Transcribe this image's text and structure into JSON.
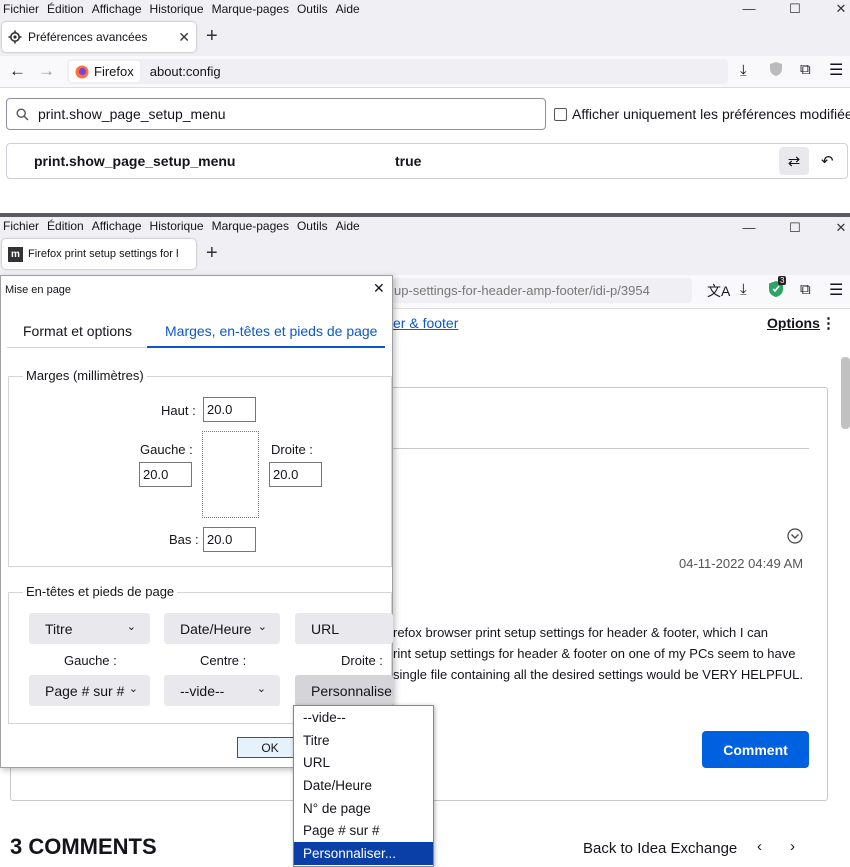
{
  "top_window": {
    "menu": [
      "Fichier",
      "Édition",
      "Affichage",
      "Historique",
      "Marque-pages",
      "Outils",
      "Aide"
    ],
    "tab_title": "Préférences avancées",
    "url_identity": "Firefox",
    "url": "about:config",
    "search_value": "print.show_page_setup_menu",
    "modified_only_label": "Afficher uniquement les préférences modifiées",
    "pref_name": "print.show_page_setup_menu",
    "pref_value": "true"
  },
  "bottom_window": {
    "menu": [
      "Fichier",
      "Édition",
      "Affichage",
      "Historique",
      "Marque-pages",
      "Outils",
      "Aide"
    ],
    "tab_title": "Firefox print setup settings for h",
    "url_partial": "up-settings-for-header-amp-footer/idi-p/3954",
    "extension_badge": "3"
  },
  "page": {
    "breadcrumb_link": "er & footer",
    "options_label": "Options",
    "date": "04-11-2022 04:49 AM",
    "body_lines": [
      "refox browser print setup settings for header & footer, which I can",
      "rint setup settings for header & footer on one of my PCs seem to have",
      "single file containing all the desired settings would be VERY HELPFUL."
    ],
    "comment_button": "Comment",
    "comments_heading": "3 COMMENTS",
    "back_link": "Back to Idea Exchange"
  },
  "dialog": {
    "title": "Mise en page",
    "tabs": [
      "Format et options",
      "Marges, en-têtes et pieds de page"
    ],
    "margins_legend": "Marges (millimètres)",
    "top_label": "Haut :",
    "top_value": "20.0",
    "left_label": "Gauche :",
    "left_value": "20.0",
    "right_label": "Droite :",
    "right_value": "20.0",
    "bottom_label": "Bas :",
    "bottom_value": "20.0",
    "hf_legend": "En-têtes et pieds de page",
    "header_left": "Titre",
    "header_center": "Date/Heure",
    "header_right": "URL",
    "pos_left": "Gauche :",
    "pos_center": "Centre :",
    "pos_right": "Droite :",
    "footer_left": "Page # sur #",
    "footer_center": "--vide--",
    "footer_right": "Personnaliser...",
    "ok_label": "OK"
  },
  "dropdown_options": [
    "--vide--",
    "Titre",
    "URL",
    "Date/Heure",
    "N° de page",
    "Page # sur #",
    "Personnaliser..."
  ],
  "dropdown_selected": "Personnaliser...",
  "colors": {
    "accent_blue": "#0061e0",
    "selected_option": "#0a3fa8",
    "chrome_bg": "#f0f0f4",
    "badge_green": "#2ca463"
  }
}
